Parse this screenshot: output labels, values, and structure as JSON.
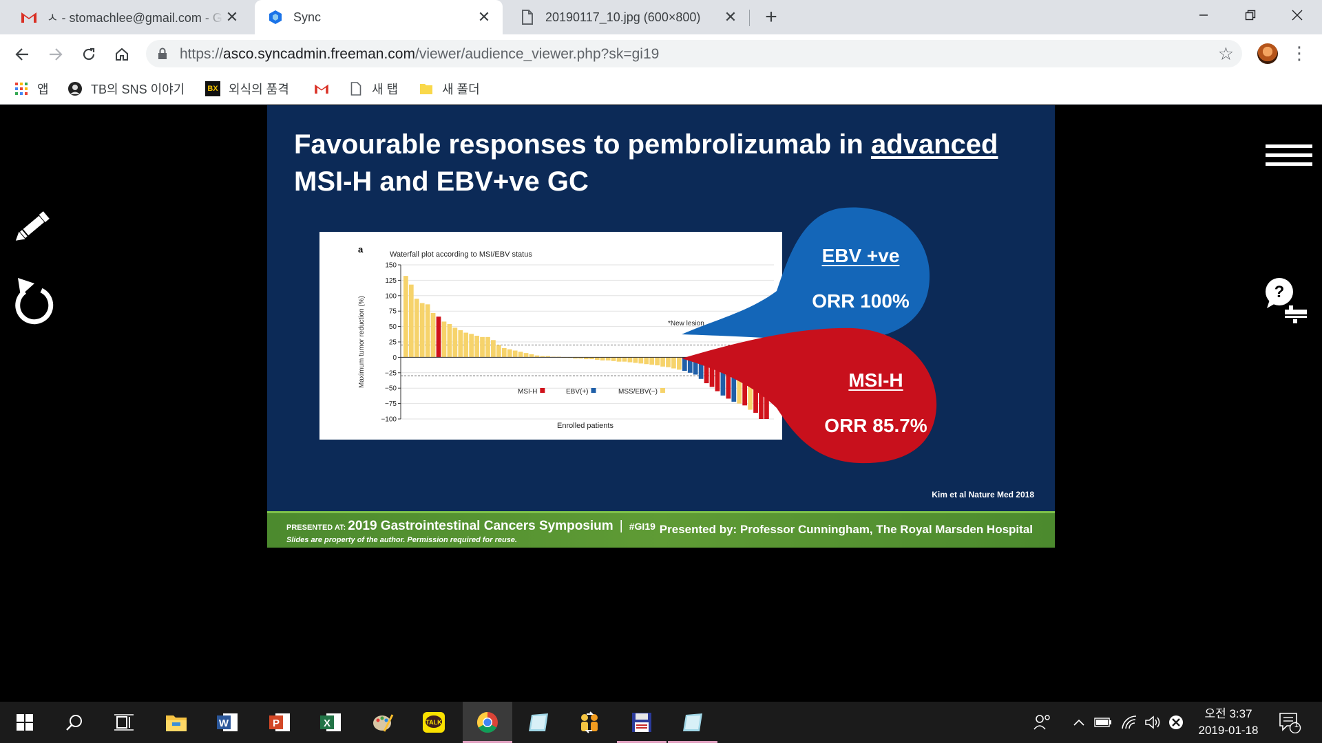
{
  "tabs": [
    {
      "title": "ㅅ - stomachlee@gmail.com - Gmail",
      "icon": "gmail-icon"
    },
    {
      "title": "Sync",
      "icon": "sync-icon"
    },
    {
      "title": "20190117_10.jpg (600×800)",
      "icon": "file-icon"
    }
  ],
  "toolbar": {
    "url_prefix": "https://",
    "url_host": "asco.syncadmin.freeman.com",
    "url_path": "/viewer/audience_viewer.php?sk=gi19"
  },
  "bookmarks": [
    {
      "label": "앱",
      "icon": "apps-grid-icon"
    },
    {
      "label": "TB의 SNS 이야기",
      "icon": "portrait-icon"
    },
    {
      "label": "외식의 품격",
      "icon": "bx-logo-icon"
    },
    {
      "label": "",
      "icon": "gmail-icon"
    },
    {
      "label": "새 탭",
      "icon": "page-icon"
    },
    {
      "label": "새 폴더",
      "icon": "folder-icon"
    }
  ],
  "slide": {
    "title_line1_pre": "Favourable responses to pembrolizumab in ",
    "title_line1_underlined": "advanced",
    "title_line2": "MSI-H and EBV+ve GC",
    "ebv_title": "EBV +ve",
    "ebv_orr": "ORR 100%",
    "msi_title": "MSI-H",
    "msi_orr": "ORR 85.7%",
    "citation": "Kim et al Nature Med 2018",
    "footer_presented_at": "PRESENTED AT:",
    "footer_event": "2019 Gastrointestinal Cancers Symposium",
    "footer_sep": "|",
    "footer_hashtag": "#GI19",
    "footer_disclaimer": "Slides are property of the author. Permission required for reuse.",
    "footer_presenter": "Presented by: Professor Cunningham, The Royal Marsden Hospital"
  },
  "chart_data": {
    "type": "bar",
    "panel_label": "a",
    "title": "Waterfall plot according to MSI/EBV status",
    "xlabel": "Enrolled patients",
    "ylabel": "Maximum tumor reduction (%)",
    "ylim": [
      -100,
      150
    ],
    "yticks": [
      150,
      125,
      100,
      75,
      50,
      25,
      0,
      -25,
      -50,
      -75,
      -100
    ],
    "grid": true,
    "reference_lines": [
      20,
      -30
    ],
    "annotation": "*New lesion",
    "legend": [
      {
        "label": "MSI-H",
        "color": "#d0121b"
      },
      {
        "label": "EBV(+)",
        "color": "#1f5fa8"
      },
      {
        "label": "MSS/EBV(−)",
        "color": "#f6d36b"
      }
    ],
    "values": [
      132,
      118,
      95,
      88,
      86,
      72,
      66,
      58,
      54,
      48,
      44,
      40,
      38,
      35,
      33,
      33,
      28,
      20,
      15,
      13,
      11,
      9,
      7,
      5,
      3,
      2,
      2,
      1,
      1,
      0,
      -1,
      -2,
      -2,
      -3,
      -3,
      -4,
      -5,
      -5,
      -6,
      -7,
      -7,
      -8,
      -9,
      -10,
      -11,
      -12,
      -13,
      -15,
      -16,
      -18,
      -20,
      -22,
      -25,
      -28,
      -35,
      -42,
      -48,
      -55,
      -62,
      -67,
      -72,
      -75,
      -78,
      -85,
      -90,
      -100,
      -100
    ],
    "groups": [
      "Y",
      "Y",
      "Y",
      "Y",
      "Y",
      "Y",
      "R",
      "Y",
      "Y",
      "Y",
      "Y",
      "Y",
      "Y",
      "Y",
      "Y",
      "Y",
      "Y",
      "Y",
      "Y",
      "Y",
      "Y",
      "Y",
      "Y",
      "Y",
      "Y",
      "Y",
      "Y",
      "Y",
      "Y",
      "Y",
      "Y",
      "Y",
      "Y",
      "Y",
      "Y",
      "Y",
      "Y",
      "Y",
      "Y",
      "Y",
      "Y",
      "Y",
      "Y",
      "Y",
      "Y",
      "Y",
      "Y",
      "Y",
      "Y",
      "Y",
      "Y",
      "B",
      "B",
      "B",
      "B",
      "R",
      "R",
      "R",
      "B",
      "R",
      "B",
      "Y",
      "R",
      "Y",
      "R",
      "R",
      "R"
    ]
  },
  "side_tools": {
    "pencil": "pencil-icon",
    "undo": "undo-icon",
    "menu": "hamburger-menu-icon",
    "help": "help-bubble-icon"
  },
  "taskbar": {
    "clock_time": "오전 3:37",
    "clock_date": "2019-01-18",
    "notification_count": "1"
  }
}
